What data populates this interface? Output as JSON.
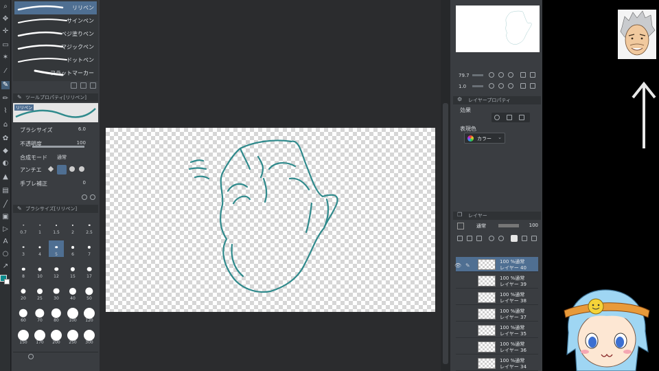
{
  "brush_list": [
    {
      "label": "リリペン",
      "active": true
    },
    {
      "label": "サインペン",
      "active": false
    },
    {
      "label": "ベジ塗りペン",
      "active": false
    },
    {
      "label": "マジックペン",
      "active": false
    },
    {
      "label": "ドットペン",
      "active": false
    },
    {
      "label": "フラットマーカー",
      "active": false
    }
  ],
  "tool_property": {
    "tab_title": "ツールプロパティ[リリペン]",
    "preview_label": "リリペン",
    "brush_size_label": "ブラシサイズ",
    "brush_size_value": "6.0",
    "opacity_label": "不透明度",
    "opacity_value": "100",
    "opacity_fraction": 1.0,
    "blend_label": "合成モード",
    "blend_value": "通常",
    "aa_label": "アンチエ",
    "stabilize_label": "手ブレ補正",
    "stabilize_value": "0"
  },
  "brush_size_panel": {
    "tab_title": "ブラシサイズ[リリペン]",
    "sizes": [
      "0.7",
      "1",
      "1.5",
      "2",
      "2.5",
      "3",
      "4",
      "5",
      "6",
      "7",
      "8",
      "10",
      "12",
      "15",
      "17",
      "20",
      "25",
      "30",
      "40",
      "50",
      "60",
      "70",
      "80",
      "100",
      "120",
      "150",
      "170",
      "200",
      "250",
      "300"
    ],
    "active": "5"
  },
  "navigator": {
    "zoom_value": "79.7",
    "rotate_value": "1.0"
  },
  "layer_property": {
    "tab_title": "レイヤープロパティ",
    "effect_label": "効果",
    "color_mode_label": "表現色",
    "color_mode_value": "カラー"
  },
  "layer_panel": {
    "tab_title": "レイヤー",
    "blend_value": "通常",
    "opacity_value": "100",
    "layers": [
      {
        "mode": "100 %通常",
        "name": "レイヤー 40",
        "active": true
      },
      {
        "mode": "100 %通常",
        "name": "レイヤー 39",
        "active": false
      },
      {
        "mode": "100 %通常",
        "name": "レイヤー 38",
        "active": false
      },
      {
        "mode": "100 %通常",
        "name": "レイヤー 37",
        "active": false
      },
      {
        "mode": "100 %通常",
        "name": "レイヤー 35",
        "active": false
      },
      {
        "mode": "100 %通常",
        "name": "レイヤー 36",
        "active": false
      },
      {
        "mode": "100 %通常",
        "name": "レイヤー 34",
        "active": false
      }
    ]
  },
  "colors": {
    "stroke": "#2f8a8c",
    "active_row": "#4f6f92",
    "panel": "#3a3d41"
  }
}
